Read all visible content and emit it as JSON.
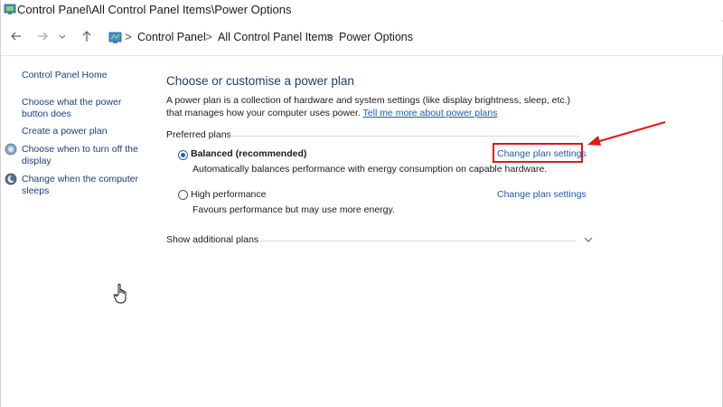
{
  "window": {
    "title": "Control Panel\\All Control Panel Items\\Power Options"
  },
  "nav": {
    "back_icon": "back-arrow-icon",
    "forward_icon": "forward-arrow-icon",
    "recent_icon": "chevron-down-icon",
    "up_icon": "up-arrow-icon",
    "breadcrumb": [
      "Control Panel",
      "All Control Panel Items",
      "Power Options"
    ],
    "separator": ">"
  },
  "sidebar": {
    "home": "Control Panel Home",
    "items": [
      {
        "label": "Choose what the power button does",
        "icon": null
      },
      {
        "label": "Create a power plan",
        "icon": null
      },
      {
        "label": "Choose when to turn off the display",
        "icon": "display-icon"
      },
      {
        "label": "Change when the computer sleeps",
        "icon": "moon-icon"
      }
    ]
  },
  "main": {
    "title": "Choose or customise a power plan",
    "description": "A power plan is a collection of hardware and system settings (like display brightness, sleep, etc.) that manages how your computer uses power.",
    "learn_more_link": "Tell me more about power plans",
    "preferred_label": "Preferred plans",
    "plans": [
      {
        "name": "Balanced (recommended)",
        "description": "Automatically balances performance with energy consumption on capable hardware.",
        "link": "Change plan settings",
        "selected": true
      },
      {
        "name": "High performance",
        "description": "Favours performance but may use more energy.",
        "link": "Change plan settings",
        "selected": false
      }
    ],
    "additional_label": "Show additional plans"
  },
  "colors": {
    "accent": "#1a5bb5",
    "highlight": "#e01a1a",
    "title": "#1c3e6e"
  }
}
